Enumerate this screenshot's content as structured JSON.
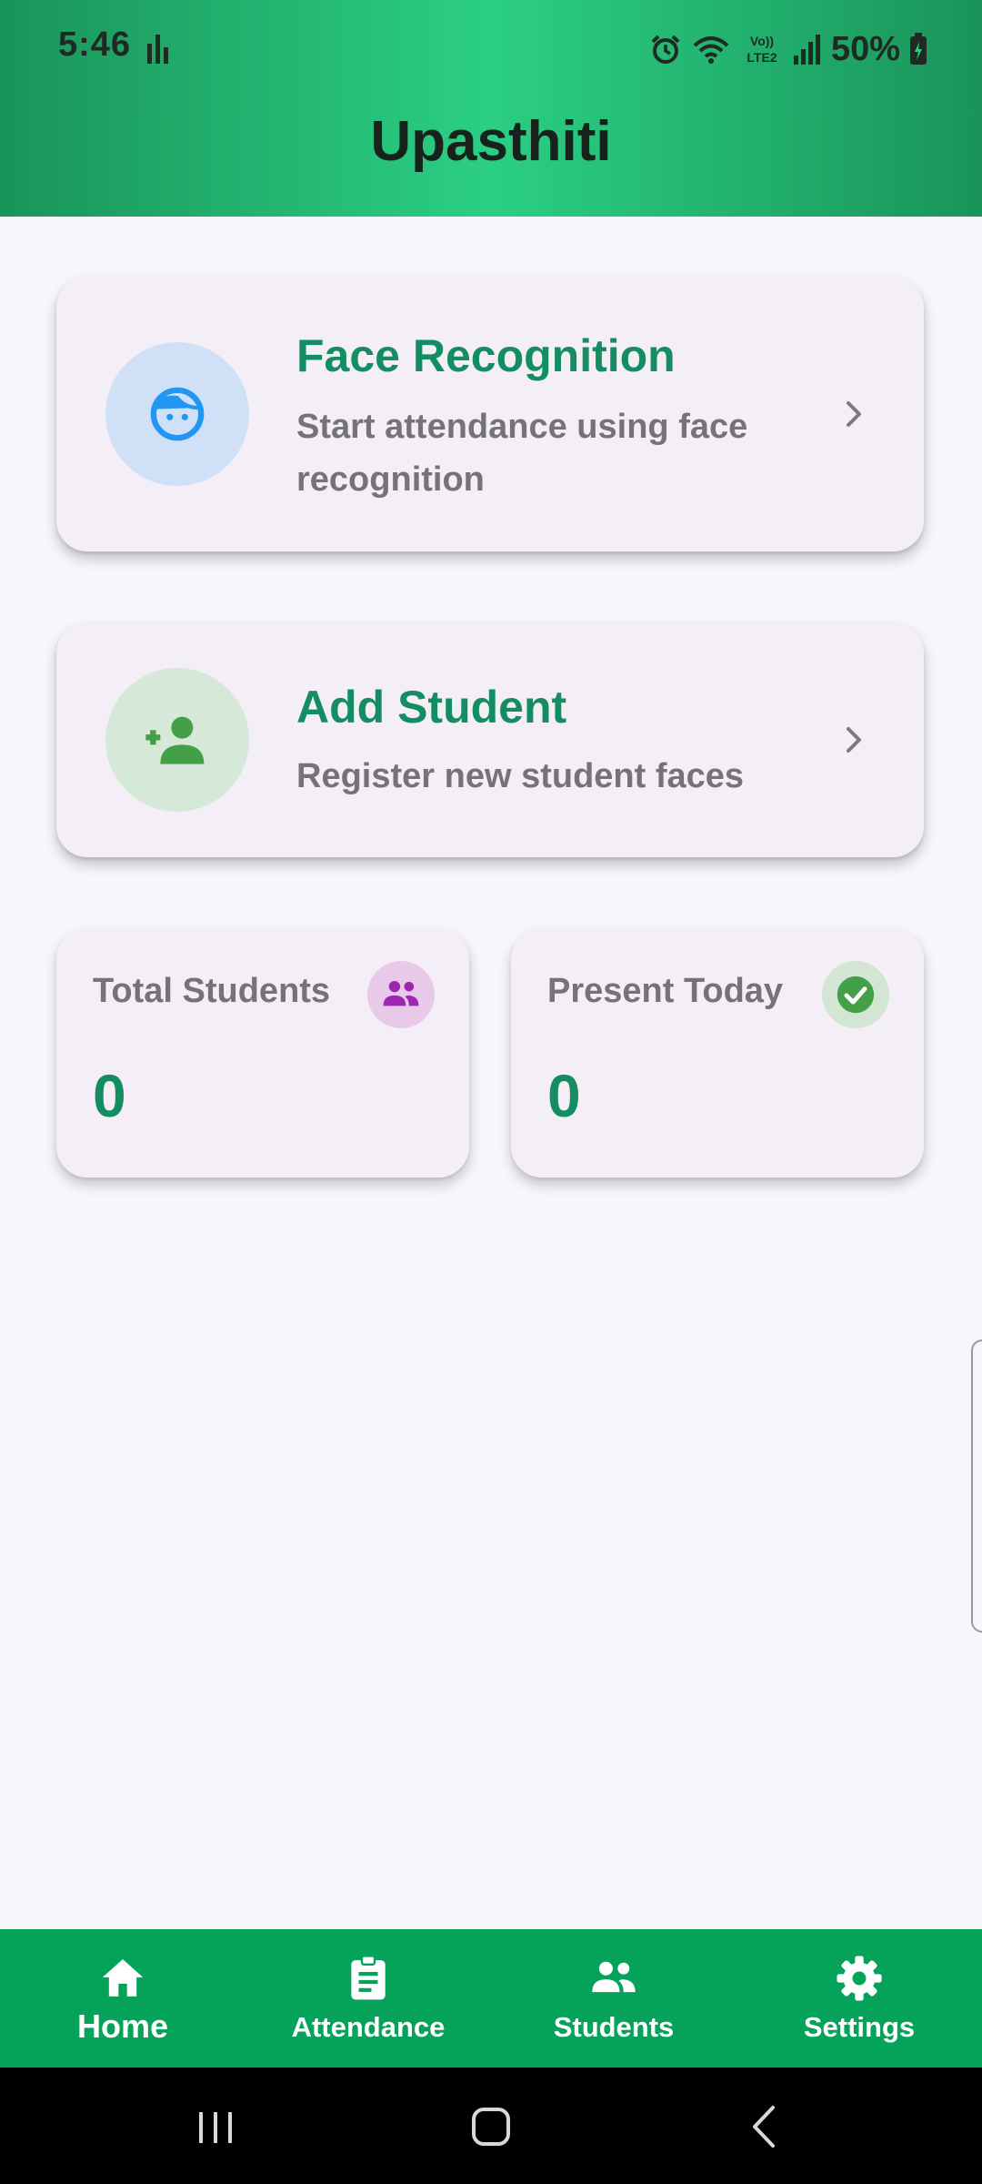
{
  "status_bar": {
    "time": "5:46",
    "battery": "50%",
    "network_label": "Vo)) LTE2"
  },
  "header": {
    "title": "Upasthiti",
    "colors": {
      "gradient_edge": "#1a9459",
      "gradient_center": "#2bcf84"
    }
  },
  "actions": [
    {
      "title": "Face Recognition",
      "description": "Start attendance using face recognition",
      "icon": "face-icon",
      "icon_color": "#2196f3"
    },
    {
      "title": "Add Student",
      "description": "Register new student faces",
      "icon": "person-add-icon",
      "icon_color": "#43a047"
    }
  ],
  "stats": {
    "total": {
      "label": "Total Students",
      "value": "0",
      "icon": "group-icon",
      "icon_color": "#9c27b0"
    },
    "present": {
      "label": "Present Today",
      "value": "0",
      "icon": "check-circle-icon",
      "icon_color": "#43a047"
    }
  },
  "bottom_nav": {
    "active": "Home",
    "items": [
      {
        "label": "Home",
        "icon": "home-icon"
      },
      {
        "label": "Attendance",
        "icon": "clipboard-icon"
      },
      {
        "label": "Students",
        "icon": "group-icon"
      },
      {
        "label": "Settings",
        "icon": "gear-icon"
      }
    ]
  },
  "colors": {
    "accent": "#138d61",
    "nav_background": "#05a25a",
    "card_background": "#f4eff6",
    "page_background": "#f7f6fb"
  }
}
